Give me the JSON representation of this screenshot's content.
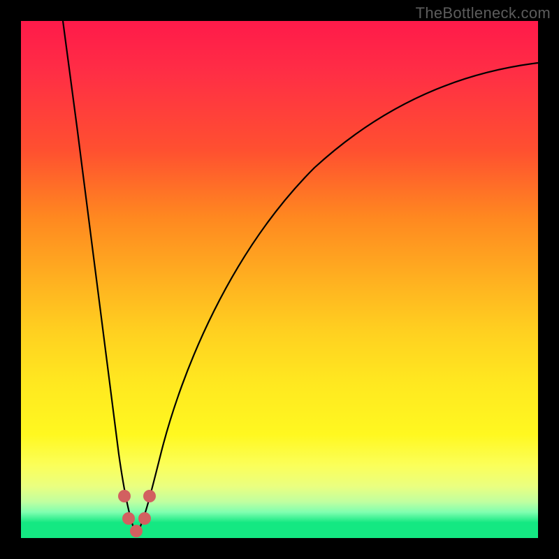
{
  "watermark": "TheBottleneck.com",
  "chart_data": {
    "type": "line",
    "title": "",
    "xlabel": "",
    "ylabel": "",
    "xlim": [
      0,
      100
    ],
    "ylim": [
      0,
      100
    ],
    "background": {
      "gradient_top": "#ff1a4a",
      "gradient_mid": "#ffd020",
      "gradient_bottom": "#14e882",
      "meaning_top": "high bottleneck",
      "meaning_bottom": "no bottleneck"
    },
    "curve": {
      "description": "V-shaped bottleneck curve; minimum near x≈22",
      "min_x": 22,
      "min_y": 0,
      "left_branch": [
        {
          "x": 8,
          "y": 100
        },
        {
          "x": 11,
          "y": 75
        },
        {
          "x": 14,
          "y": 50
        },
        {
          "x": 17,
          "y": 25
        },
        {
          "x": 19,
          "y": 8
        },
        {
          "x": 21,
          "y": 1
        },
        {
          "x": 22,
          "y": 0
        }
      ],
      "right_branch": [
        {
          "x": 22,
          "y": 0
        },
        {
          "x": 24,
          "y": 2
        },
        {
          "x": 27,
          "y": 12
        },
        {
          "x": 32,
          "y": 30
        },
        {
          "x": 40,
          "y": 50
        },
        {
          "x": 55,
          "y": 70
        },
        {
          "x": 75,
          "y": 82
        },
        {
          "x": 100,
          "y": 90
        }
      ]
    },
    "markers": [
      {
        "x": 19.5,
        "y": 7
      },
      {
        "x": 20.5,
        "y": 2
      },
      {
        "x": 22,
        "y": 0
      },
      {
        "x": 23.5,
        "y": 2
      },
      {
        "x": 24.5,
        "y": 7
      }
    ],
    "colors": {
      "curve": "#000000",
      "markers": "#d26060"
    }
  }
}
